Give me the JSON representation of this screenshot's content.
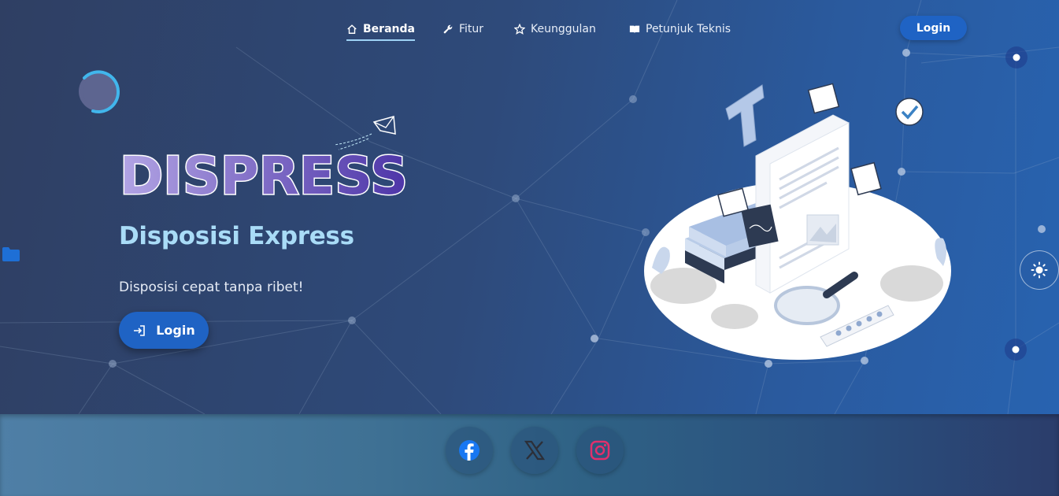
{
  "nav": {
    "items": [
      {
        "label": "Beranda",
        "icon": "home-icon",
        "active": true
      },
      {
        "label": "Fitur",
        "icon": "wrench-icon"
      },
      {
        "label": "Keunggulan",
        "icon": "star-icon"
      },
      {
        "label": "Petunjuk Teknis",
        "icon": "book-icon"
      }
    ],
    "login_label": "Login"
  },
  "hero": {
    "brand": "DISPRESS",
    "subtitle": "Disposisi Express",
    "tagline": "Disposisi cepat tanpa ribet!",
    "login_label": "Login"
  },
  "footer": {
    "social": [
      {
        "name": "facebook-icon",
        "color": "#1877f2"
      },
      {
        "name": "x-icon",
        "color": "#2c2f38"
      },
      {
        "name": "instagram-icon",
        "color": "#e1306c"
      }
    ]
  },
  "colors": {
    "accent": "#1f63c4",
    "subtitle": "#a9dcf7",
    "brand_light": "#a99be0",
    "brand_dark": "#5a3fb0"
  }
}
